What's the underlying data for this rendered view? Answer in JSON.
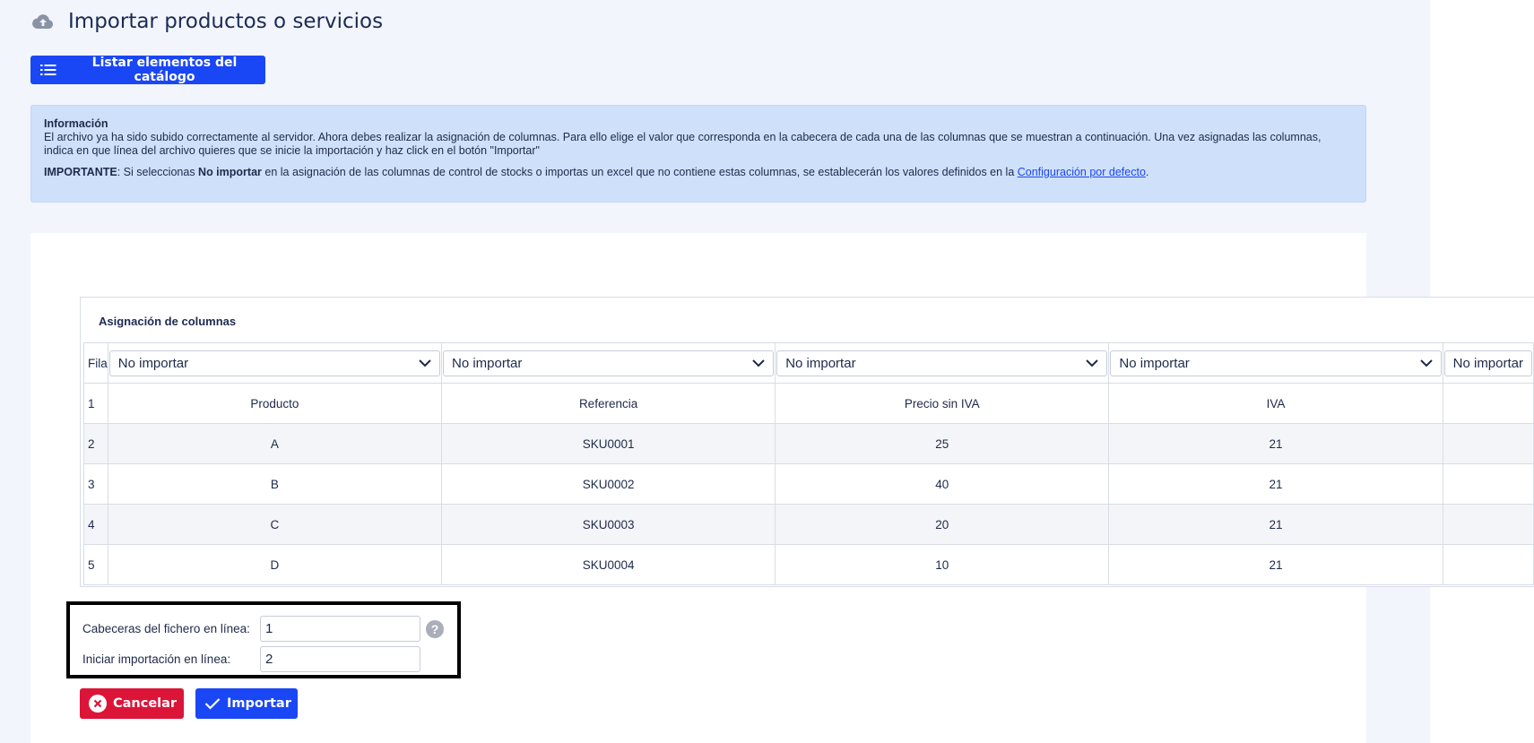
{
  "header": {
    "title": "Importar productos o servicios",
    "icon": "cloud-upload-icon"
  },
  "toolbar": {
    "list_label": "Listar elementos del catálogo"
  },
  "info": {
    "title": "Información",
    "text": "El archivo ya ha sido subido correctamente al servidor. Ahora debes realizar la asignación de columnas. Para ello elige el valor que corresponda en la cabecera de cada una de las columnas que se muestran a continuación. Una vez asignadas las columnas, indica en que línea del archivo quieres que se inicie la importación y haz click en el botón \"Importar\"",
    "important_label": "IMPORTANTE",
    "important_part1": ": Si seleccionas ",
    "important_bold": "No importar",
    "important_part2": " en la asignación de las columnas de control de stocks o importas un excel que no contiene estas columnas, se establecerán los valores definidos en la ",
    "important_link": "Configuración por defecto",
    "important_end": "."
  },
  "mapping": {
    "title": "Asignación de columnas",
    "row_header": "Fila",
    "selects": [
      "No importar",
      "No importar",
      "No importar",
      "No importar",
      "No importar"
    ],
    "rows": [
      {
        "n": "1",
        "cells": [
          "Producto",
          "Referencia",
          "Precio sin IVA",
          "IVA",
          ""
        ]
      },
      {
        "n": "2",
        "cells": [
          "A",
          "SKU0001",
          "25",
          "21",
          ""
        ]
      },
      {
        "n": "3",
        "cells": [
          "B",
          "SKU0002",
          "40",
          "21",
          ""
        ]
      },
      {
        "n": "4",
        "cells": [
          "C",
          "SKU0003",
          "20",
          "21",
          ""
        ]
      },
      {
        "n": "5",
        "cells": [
          "D",
          "SKU0004",
          "10",
          "21",
          ""
        ]
      }
    ]
  },
  "settings": {
    "header_line_label": "Cabeceras del fichero en línea:",
    "header_line_value": "1",
    "start_line_label": "Iniciar importación en línea:",
    "start_line_value": "2",
    "help": "?"
  },
  "actions": {
    "cancel_label": "Cancelar",
    "import_label": "Importar"
  },
  "colors": {
    "primary": "#1a47f5",
    "danger": "#dc1438",
    "info_bg": "#cfe0fb",
    "page_bg": "#f2f5fc"
  }
}
